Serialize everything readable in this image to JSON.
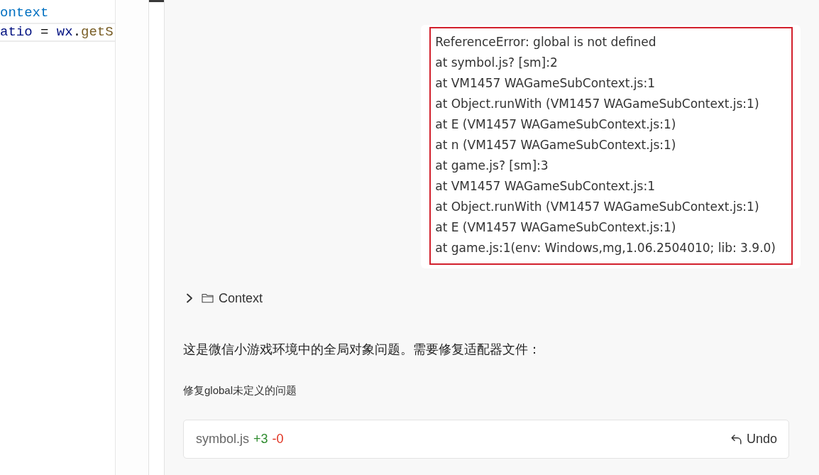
{
  "editor": {
    "lines": [
      {
        "highlighted": false,
        "tokens": [
          {
            "text": "ontext",
            "kind": "type"
          }
        ]
      },
      {
        "highlighted": true,
        "tokens": [
          {
            "text": "atio",
            "kind": "variable"
          },
          {
            "text": " = ",
            "kind": "operator"
          },
          {
            "text": "wx",
            "kind": "variable"
          },
          {
            "text": ".",
            "kind": "operator"
          },
          {
            "text": "getS",
            "kind": "function"
          }
        ]
      }
    ]
  },
  "chat": {
    "user_message": {
      "lines": [
        "ReferenceError: global is not defined",
        "at symbol.js? [sm]:2",
        "at VM1457 WAGameSubContext.js:1",
        "at Object.runWith (VM1457 WAGameSubContext.js:1)",
        "at E (VM1457 WAGameSubContext.js:1)",
        "at n (VM1457 WAGameSubContext.js:1)",
        "at game.js? [sm]:3",
        "at VM1457 WAGameSubContext.js:1",
        "at Object.runWith (VM1457 WAGameSubContext.js:1)",
        "at E (VM1457 WAGameSubContext.js:1)",
        "at game.js:1(env: Windows,mg,1.06.2504010; lib: 3.9.0)"
      ]
    },
    "context": {
      "label": "Context",
      "expanded": false
    },
    "reply": "这是微信小游戏环境中的全局对象问题。需要修复适配器文件：",
    "edit_title": "修复global未定义的问题",
    "file_change": {
      "file": "symbol.js",
      "added": "+3",
      "removed": "-0",
      "action": "Undo"
    }
  }
}
